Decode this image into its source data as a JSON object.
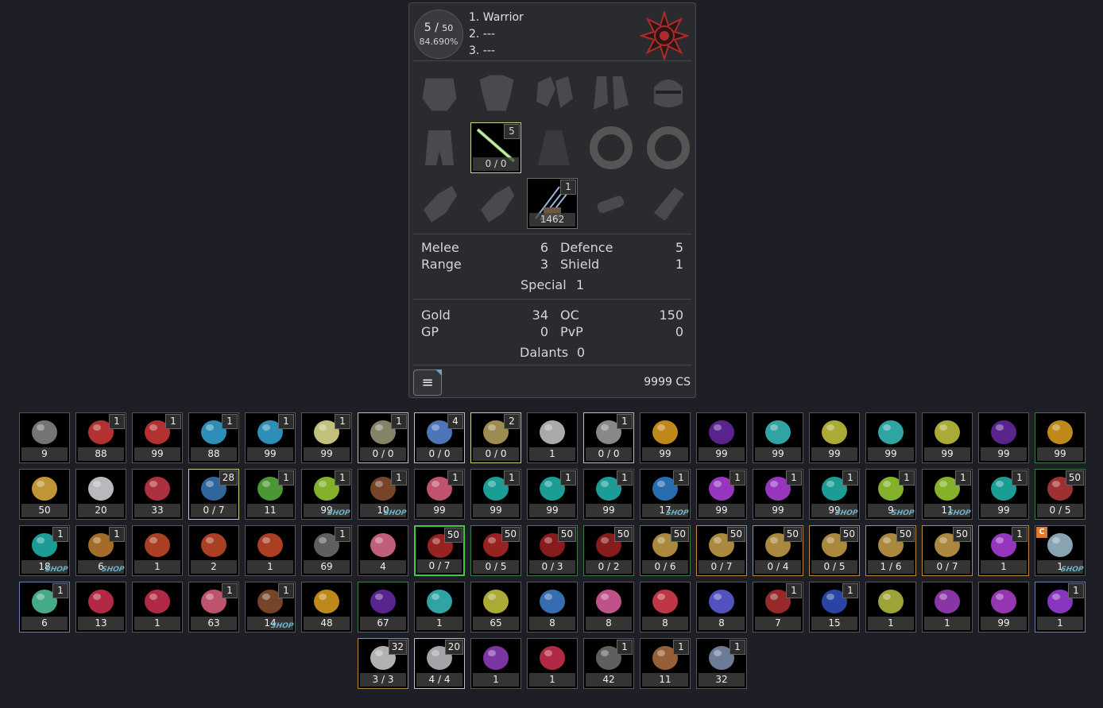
{
  "character": {
    "level": "5",
    "level_max": "50",
    "exp_percent": "84.690%",
    "classes": [
      "1. Warrior",
      "2. ---",
      "3. ---"
    ],
    "emblem_icon": "sun-emblem-icon"
  },
  "equipment": {
    "weapon": {
      "badge": "5",
      "count": "0 / 0"
    },
    "ammo": {
      "badge": "1",
      "count": "1462"
    }
  },
  "attack_defence": {
    "melee_label": "Melee",
    "melee": "6",
    "range_label": "Range",
    "range": "3",
    "defence_label": "Defence",
    "defence": "5",
    "shield_label": "Shield",
    "shield": "1",
    "special_label": "Special",
    "special": "1"
  },
  "currency": {
    "gold_label": "Gold",
    "gold": "34",
    "gp_label": "GP",
    "gp": "0",
    "oc_label": "OC",
    "oc": "150",
    "pvp_label": "PvP",
    "pvp": "0",
    "dalants_label": "Dalants",
    "dalants": "0",
    "cs": "9999 CS"
  },
  "colors": {
    "panel_bg": "#2a2b2f",
    "page_bg": "#1e1f26",
    "accent_red": "#b02a2a"
  },
  "inventory": [
    {
      "count": "9",
      "icon": "metal-crate-icon"
    },
    {
      "count": "88",
      "badge": "1",
      "icon": "red-potion-icon"
    },
    {
      "count": "99",
      "badge": "1",
      "icon": "red-potion-icon"
    },
    {
      "count": "88",
      "badge": "1",
      "icon": "blue-potion-icon"
    },
    {
      "count": "99",
      "badge": "1",
      "icon": "blue-potion-icon"
    },
    {
      "count": "99",
      "badge": "1",
      "icon": "yellow-potion-icon"
    },
    {
      "count": "0 / 0",
      "badge": "1",
      "icon": "spear-icon"
    },
    {
      "count": "0 / 0",
      "badge": "4",
      "icon": "blue-ship-icon"
    },
    {
      "count": "0 / 0",
      "badge": "2",
      "icon": "staff-icon"
    },
    {
      "count": "1",
      "icon": "armor-chest-icon"
    },
    {
      "count": "0 / 0",
      "badge": "1",
      "icon": "bow-icon"
    },
    {
      "count": "99",
      "icon": "cyan-crystal-icon"
    },
    {
      "count": "99",
      "icon": "purple-gem-icon"
    },
    {
      "count": "99",
      "icon": "cyan-bar-icon"
    },
    {
      "count": "99",
      "icon": "yellow-gem-icon"
    },
    {
      "count": "99",
      "icon": "cyan-bar-icon"
    },
    {
      "count": "99",
      "icon": "yellow-gem-icon"
    },
    {
      "count": "99",
      "icon": "purple-gem-icon"
    },
    {
      "count": "99",
      "icon": "cyan-crystal-icon"
    },
    {
      "count": "50",
      "icon": "yellow-helmet-icon"
    },
    {
      "count": "20",
      "icon": "white-helmet-icon"
    },
    {
      "count": "33",
      "icon": "red-ruby-icon"
    },
    {
      "count": "0 / 7",
      "badge": "28",
      "icon": "cannon-icon"
    },
    {
      "count": "11",
      "badge": "1",
      "icon": "green-orb-device-icon"
    },
    {
      "count": "99",
      "badge": "1",
      "icon": "green-orb-icon",
      "shop": "SHOP"
    },
    {
      "count": "10",
      "badge": "1",
      "icon": "love-chocolate-icon",
      "shop": "SHOP"
    },
    {
      "count": "99",
      "badge": "1",
      "icon": "pink-flask-icon"
    },
    {
      "count": "99",
      "badge": "1",
      "icon": "teal-orb-icon"
    },
    {
      "count": "99",
      "badge": "1",
      "icon": "teal-orb-icon"
    },
    {
      "count": "99",
      "badge": "1",
      "icon": "teal-orb-icon"
    },
    {
      "count": "17",
      "badge": "1",
      "icon": "blue-scope-icon",
      "shop": "SHOP"
    },
    {
      "count": "99",
      "badge": "1",
      "icon": "purple-flask-icon"
    },
    {
      "count": "99",
      "badge": "1",
      "icon": "purple-flask-icon"
    },
    {
      "count": "99",
      "badge": "1",
      "icon": "teal-orb-icon",
      "shop": "SHOP"
    },
    {
      "count": "9",
      "badge": "1",
      "icon": "green-orb-icon",
      "shop": "SHOP"
    },
    {
      "count": "11",
      "badge": "1",
      "icon": "green-orb-icon",
      "shop": "SHOP"
    },
    {
      "count": "99",
      "badge": "1",
      "icon": "teal-orb-icon"
    },
    {
      "count": "0 / 5",
      "badge": "50",
      "icon": "red-claw-icon"
    },
    {
      "count": "18",
      "badge": "1",
      "icon": "teal-orb-icon",
      "shop": "SHOP"
    },
    {
      "count": "6",
      "badge": "1",
      "icon": "mixed-orb-icon",
      "shop": "SHOP"
    },
    {
      "count": "1",
      "icon": "cake-box-icon"
    },
    {
      "count": "2",
      "icon": "cake-box-icon"
    },
    {
      "count": "1",
      "icon": "cake-box-icon"
    },
    {
      "count": "69",
      "badge": "1",
      "icon": "grey-device-icon"
    },
    {
      "count": "4",
      "icon": "pink-crystal-icon"
    },
    {
      "count": "0 / 7",
      "badge": "50",
      "icon": "red-armor-icon"
    },
    {
      "count": "0 / 5",
      "badge": "50",
      "icon": "red-armor-icon"
    },
    {
      "count": "0 / 3",
      "badge": "50",
      "icon": "red-legs-icon"
    },
    {
      "count": "0 / 2",
      "badge": "50",
      "icon": "red-legs-icon"
    },
    {
      "count": "0 / 6",
      "badge": "50",
      "icon": "gold-armor-icon"
    },
    {
      "count": "0 / 7",
      "badge": "50",
      "icon": "gold-armor-icon"
    },
    {
      "count": "0 / 4",
      "badge": "50",
      "icon": "gold-armor-icon"
    },
    {
      "count": "0 / 5",
      "badge": "50",
      "icon": "gold-armor-icon"
    },
    {
      "count": "1 / 6",
      "badge": "50",
      "icon": "gold-armor-icon"
    },
    {
      "count": "0 / 7",
      "badge": "50",
      "icon": "gold-armor-icon"
    },
    {
      "count": "1",
      "badge": "1",
      "icon": "purple-flask-icon"
    },
    {
      "count": "1",
      "cbadge": "C",
      "icon": "silver-shield-icon",
      "shop": "SHOP"
    },
    {
      "count": "6",
      "badge": "1",
      "icon": "green-capsule-icon"
    },
    {
      "count": "13",
      "icon": "red-mech-icon"
    },
    {
      "count": "1",
      "icon": "red-mech-icon"
    },
    {
      "count": "63",
      "badge": "1",
      "icon": "pink-flask-icon"
    },
    {
      "count": "14",
      "badge": "1",
      "icon": "love-chocolate-icon",
      "shop": "SHOP"
    },
    {
      "count": "48",
      "icon": "cyan-crystal-icon"
    },
    {
      "count": "67",
      "icon": "purple-gem-icon"
    },
    {
      "count": "1",
      "icon": "cyan-bar-icon"
    },
    {
      "count": "65",
      "icon": "yellow-gem-icon"
    },
    {
      "count": "8",
      "icon": "blue-tool-icon"
    },
    {
      "count": "8",
      "icon": "pink-diamond-icon"
    },
    {
      "count": "8",
      "icon": "red-diamond-icon"
    },
    {
      "count": "8",
      "icon": "blue-diamond-icon"
    },
    {
      "count": "7",
      "badge": "1",
      "icon": "red-coin-icon"
    },
    {
      "count": "15",
      "badge": "1",
      "icon": "blue-coin-icon"
    },
    {
      "count": "1",
      "icon": "yellow-feather-icon"
    },
    {
      "count": "1",
      "icon": "purple-feather-icon"
    },
    {
      "count": "99",
      "icon": "purple-rock-icon"
    },
    {
      "count": "1",
      "badge": "1",
      "icon": "purple-box-icon"
    },
    {
      "count": "3 / 3",
      "badge": "32",
      "icon": "white-gun-icon"
    },
    {
      "count": "4 / 4",
      "badge": "20",
      "icon": "white-rifle-icon"
    },
    {
      "count": "1",
      "icon": "purple-jar-icon"
    },
    {
      "count": "1",
      "icon": "red-mech-icon"
    },
    {
      "count": "42",
      "badge": "1",
      "icon": "grey-device-icon"
    },
    {
      "count": "11",
      "badge": "1",
      "icon": "copper-coin-icon"
    },
    {
      "count": "32",
      "badge": "1",
      "icon": "signal-device-icon"
    }
  ]
}
